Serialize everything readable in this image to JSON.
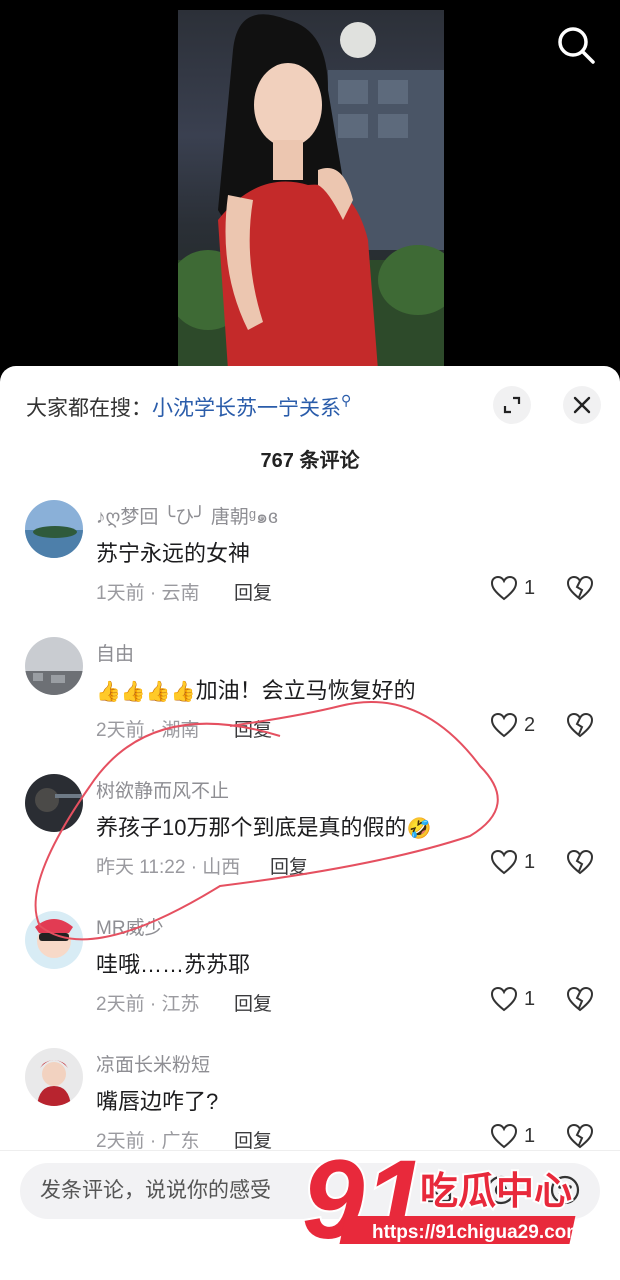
{
  "sheet": {
    "search_prefix": "大家都在搜：",
    "search_link": "小沈学长苏一宁关系",
    "comment_count": "767 条评论"
  },
  "comments": [
    {
      "name": "♪ღ梦回 ╰ひ╯ 唐朝ᵍ๑ɞ",
      "text": "苏宁永远的女神",
      "meta": "1天前 · 云南",
      "reply": "回复",
      "likes": "1"
    },
    {
      "name": "自由",
      "text": "加油！会立马恢复好的",
      "emoji_prefix": "👍👍👍👍",
      "meta": "2天前 · 湖南",
      "reply": "回复",
      "likes": "2"
    },
    {
      "name": "树欲静而风不止",
      "text": "养孩子10万那个到底是真的假的",
      "emoji_suffix": "🤣",
      "meta": "昨天 11:22 · 山西",
      "reply": "回复",
      "likes": "1"
    },
    {
      "name": "MR威少",
      "text": "哇哦……苏苏耶",
      "meta": "2天前 · 江苏",
      "reply": "回复",
      "likes": "1"
    },
    {
      "name": "凉面长米粉短",
      "text": "嘴唇边咋了?",
      "meta": "2天前 · 广东",
      "reply": "回复",
      "likes": "1"
    }
  ],
  "input": {
    "placeholder": "发条评论，说说你的感受"
  },
  "watermark": {
    "number": "91",
    "title": "吃瓜中心",
    "url": "https://91chigua29.com"
  },
  "colors": {
    "link": "#2a5caa",
    "watermark_red": "#e8293b"
  }
}
